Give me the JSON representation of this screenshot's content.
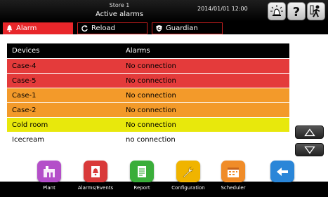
{
  "header": {
    "store": "Store 1",
    "title": "Active alarms",
    "datetime": "2014/01/01  12:00"
  },
  "tabs": [
    {
      "label": "Alarm",
      "icon": "bell-icon"
    },
    {
      "label": "Reload",
      "icon": "reload-icon"
    },
    {
      "label": "Guardian",
      "icon": "guardian-icon"
    }
  ],
  "table": {
    "columns": [
      "Devices",
      "Alarms"
    ],
    "rows": [
      {
        "device": "Case-4",
        "alarm": "No connection",
        "color": "#e43b3b"
      },
      {
        "device": "Case-5",
        "alarm": "No connection",
        "color": "#e43b3b"
      },
      {
        "device": "Case-1",
        "alarm": "No connection",
        "color": "#f39a2a"
      },
      {
        "device": "Case-2",
        "alarm": "No connection",
        "color": "#f39a2a"
      },
      {
        "device": "Cold room",
        "alarm": "No connection",
        "color": "#e8e80c"
      },
      {
        "device": "Icecream",
        "alarm": "no connection",
        "color": "#ffffff"
      }
    ]
  },
  "nav": [
    {
      "label": "Plant",
      "icon": "plant-icon",
      "color": "#b44fc9"
    },
    {
      "label": "Alarms/Events",
      "icon": "alarms-events-icon",
      "color": "#d93a3a"
    },
    {
      "label": "Report",
      "icon": "report-icon",
      "color": "#3aae3a"
    },
    {
      "label": "Configuration",
      "icon": "wrench-icon",
      "color": "#f0b400"
    },
    {
      "label": "Scheduler",
      "icon": "scheduler-icon",
      "color": "#f08c28"
    },
    {
      "label": "",
      "icon": "back-arrow-icon",
      "color": "#2a86d8"
    }
  ]
}
